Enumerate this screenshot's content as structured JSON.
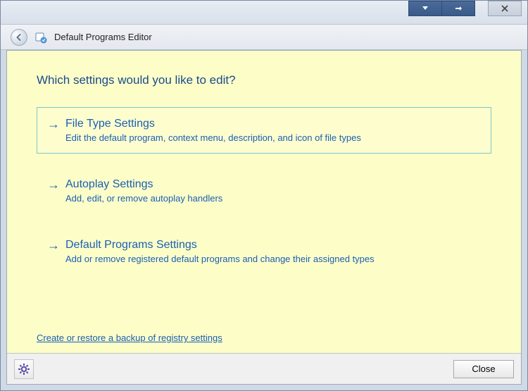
{
  "window": {
    "breadcrumb": "Default Programs Editor"
  },
  "main": {
    "heading": "Which settings would you like to edit?",
    "options": [
      {
        "title": "File Type Settings",
        "desc": "Edit the default program, context menu, description, and icon of file types",
        "selected": true
      },
      {
        "title": "Autoplay Settings",
        "desc": "Add, edit, or remove autoplay handlers",
        "selected": false
      },
      {
        "title": "Default Programs Settings",
        "desc": "Add or remove registered default programs and change their assigned types",
        "selected": false
      }
    ],
    "backup_link": "Create or restore a backup of registry settings"
  },
  "footer": {
    "close_label": "Close"
  }
}
